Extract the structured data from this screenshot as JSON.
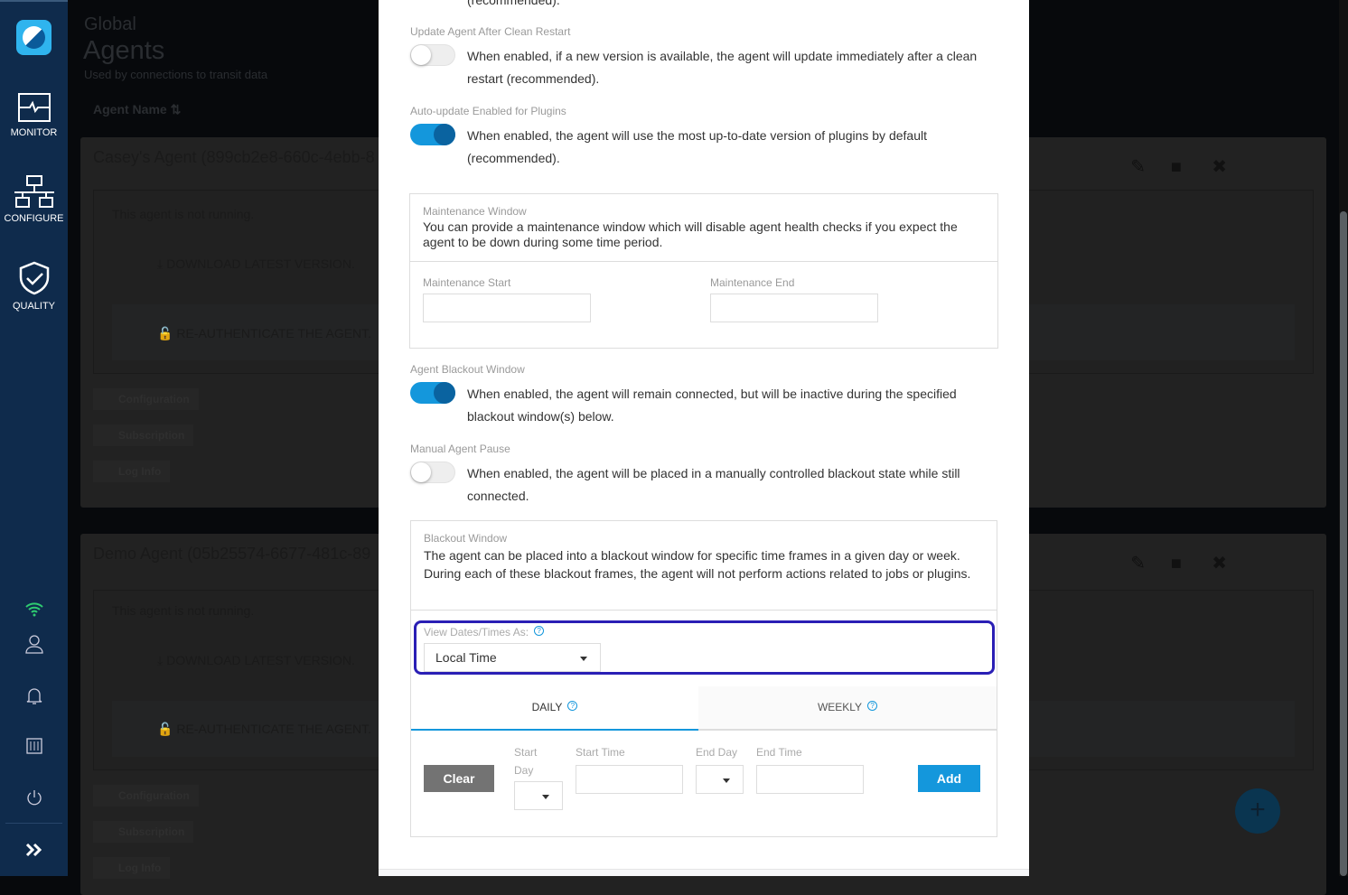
{
  "sidebar": {
    "nav": [
      {
        "label": "MONITOR",
        "icon": "monitor-icon"
      },
      {
        "label": "CONFIGURE",
        "icon": "network-icon"
      },
      {
        "label": "QUALITY",
        "icon": "shield-check-icon"
      }
    ],
    "bottom_icons": [
      "wifi-icon",
      "user-icon",
      "bell-icon",
      "sliders-icon",
      "power-icon",
      "expand-icon"
    ],
    "wifi_color": "#2ecc71"
  },
  "page": {
    "breadcrumb": "Global",
    "title": "Agents",
    "subtitle": "Used by connections to transit data",
    "sort_label": "Agent Name"
  },
  "agents": [
    {
      "title": "Casey's Agent (899cb2e8-660c-4ebb-8",
      "status": "This agent is not running.",
      "download": "DOWNLOAD LATEST VERSION.",
      "reauth": "RE-AUTHENTICATE THE AGENT.",
      "sections": [
        "Configuration",
        "Subscription",
        "Log Info"
      ]
    },
    {
      "title": "Demo Agent (05b25574-6677-481c-89",
      "status": "This agent is not running.",
      "download": "DOWNLOAD LATEST VERSION.",
      "reauth": "RE-AUTHENTICATE THE AGENT.",
      "sections": [
        "Configuration",
        "Subscription",
        "Log Info"
      ]
    }
  ],
  "modal": {
    "top_cut": "(recommended).",
    "settings": [
      {
        "label": "Update Agent After Clean Restart",
        "enabled": false,
        "desc": "When enabled, if a new version is available, the agent will update immediately after a clean restart (recommended)."
      },
      {
        "label": "Auto-update Enabled for Plugins",
        "enabled": true,
        "desc": "When enabled, the agent will use the most up-to-date version of plugins by default (recommended)."
      },
      {
        "label": "Agent Blackout Window",
        "enabled": true,
        "desc": "When enabled, the agent will remain connected, but will be inactive during the specified blackout window(s) below."
      },
      {
        "label": "Manual Agent Pause",
        "enabled": false,
        "desc": "When enabled, the agent will be placed in a manually controlled blackout state while still connected."
      }
    ],
    "maintenance": {
      "title": "Maintenance Window",
      "desc": "You can provide a maintenance window which will disable agent health checks if you expect the agent to be down during some time period.",
      "start_label": "Maintenance Start",
      "end_label": "Maintenance End",
      "start_value": "",
      "end_value": ""
    },
    "blackout": {
      "title": "Blackout Window",
      "desc": "The agent can be placed into a blackout window for specific time frames in a given day or week. During each of these blackout frames, the agent will not perform actions related to jobs or plugins.",
      "view_label": "View Dates/Times As:",
      "view_value": "Local Time",
      "tabs": [
        {
          "label": "DAILY",
          "active": true
        },
        {
          "label": "WEEKLY",
          "active": false
        }
      ],
      "clear": "Clear",
      "start_day": "Start Day",
      "start_time": "Start Time",
      "end_day": "End Day",
      "end_time": "End Time",
      "add": "Add"
    }
  },
  "colors": {
    "accent": "#1497dc",
    "focus": "#2a1fb5",
    "sidebar": "#0f2b4c"
  }
}
